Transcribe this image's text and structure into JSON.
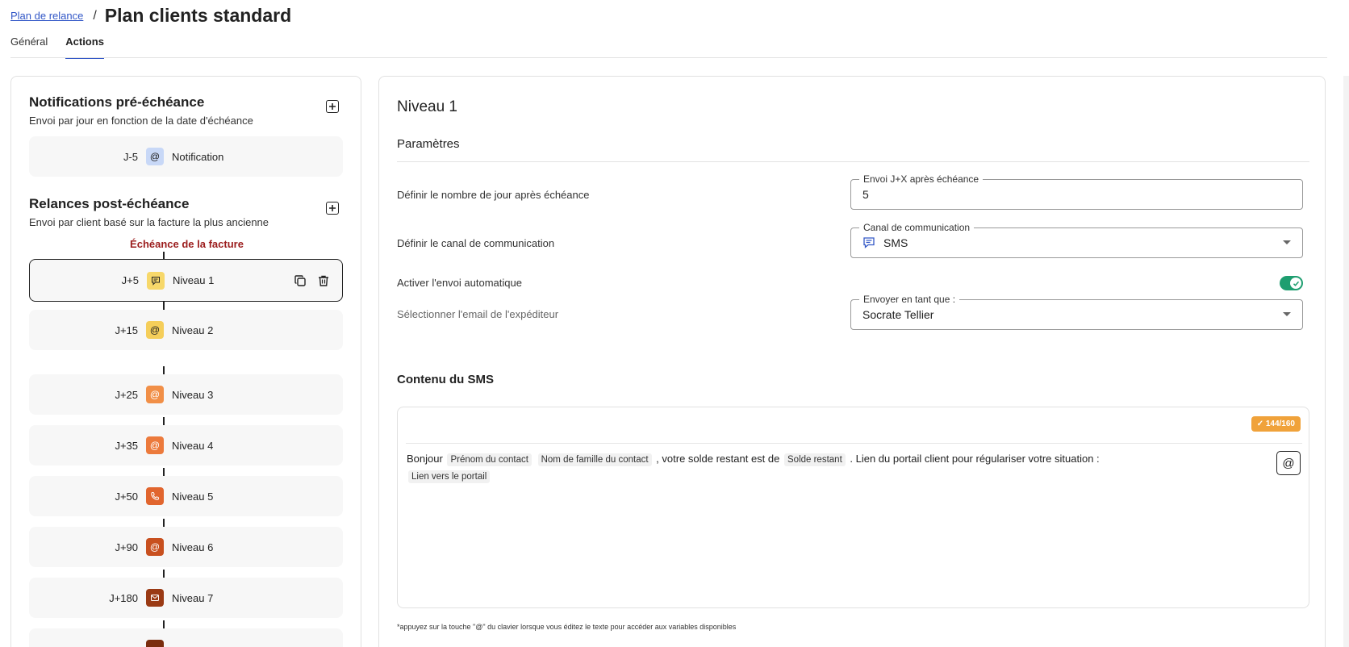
{
  "breadcrumb": {
    "parent": "Plan de relance",
    "separator": "/",
    "title": "Plan clients standard"
  },
  "tabs": [
    {
      "label": "Général"
    },
    {
      "label": "Actions"
    }
  ],
  "left": {
    "pre": {
      "title": "Notifications pré-échéance",
      "subtitle": "Envoi par jour en fonction de la date d'échéance"
    },
    "notification": {
      "day": "J-5",
      "icon": "at-icon",
      "label": "Notification"
    },
    "post": {
      "title": "Relances post-échéance",
      "subtitle": "Envoi par client basé sur la facture la plus ancienne"
    },
    "due_label": "Échéance de la facture",
    "steps": [
      {
        "day": "J+5",
        "label": "Niveau 1",
        "icon": "chat-icon",
        "color": "#f7d86a"
      },
      {
        "day": "J+15",
        "label": "Niveau 2",
        "icon": "at-icon",
        "color": "#f5ce5a"
      },
      {
        "day": "J+25",
        "label": "Niveau 3",
        "icon": "at-icon",
        "color": "#f18f47"
      },
      {
        "day": "J+35",
        "label": "Niveau 4",
        "icon": "at-icon",
        "color": "#ec7a3c"
      },
      {
        "day": "J+50",
        "label": "Niveau 5",
        "icon": "phone-icon",
        "color": "#e1652e"
      },
      {
        "day": "J+90",
        "label": "Niveau 6",
        "icon": "at-icon",
        "color": "#c8501f"
      },
      {
        "day": "J+180",
        "label": "Niveau 7",
        "icon": "mail-icon",
        "color": "#9a3a14"
      }
    ]
  },
  "right": {
    "level_title": "Niveau 1",
    "params_title": "Paramètres",
    "rows": {
      "days_label": "Définir le nombre de jour après échéance",
      "days_legend": "Envoi J+X après échéance",
      "days_value": "5",
      "channel_label": "Définir le canal de communication",
      "channel_legend": "Canal de communication",
      "channel_value": "SMS",
      "auto_label": "Activer l'envoi automatique",
      "sender_label": "Sélectionner l'email de l'expéditeur",
      "sender_legend": "Envoyer en tant que :",
      "sender_value": "Socrate Tellier"
    },
    "sms": {
      "title": "Contenu du SMS",
      "counter": "✓ 144/160",
      "t1": "Bonjour",
      "v1": "Prénom du contact",
      "v2": "Nom de famille du contact",
      "t2": ", votre solde restant est de",
      "v3": "Solde restant",
      "t3": ". Lien du portail client pour régulariser votre situation :",
      "v4": "Lien vers le portail",
      "at": "@"
    },
    "footnote": "*appuyez sur la touche \"@\" du clavier lorsque vous éditez le texte pour accéder aux variables disponibles"
  }
}
